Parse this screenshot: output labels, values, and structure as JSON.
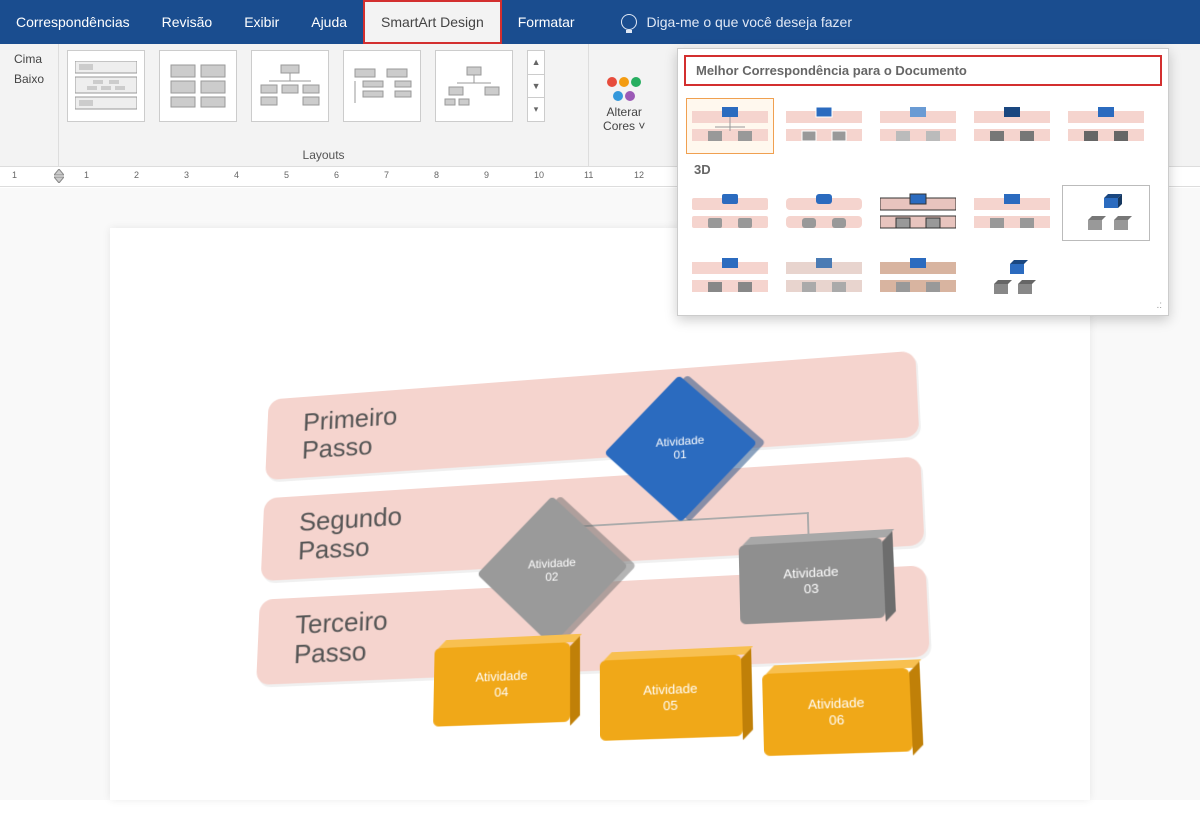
{
  "ribbon": {
    "tabs": [
      "Correspondências",
      "Revisão",
      "Exibir",
      "Ajuda",
      "SmartArt Design",
      "Formatar"
    ],
    "active_tab": "SmartArt Design",
    "tell_me": "Diga-me o que você deseja fazer",
    "move_up": "Cima",
    "move_down": "Baixo",
    "layouts_label": "Layouts",
    "change_colors": "Alterar Cores"
  },
  "gallery": {
    "best_match": "Melhor Correspondência para o Documento",
    "section_3d": "3D"
  },
  "smartart": {
    "step1": "Primeiro Passo",
    "step2": "Segundo Passo",
    "step3": "Terceiro Passo",
    "act1": "Atividade 01",
    "act2": "Atividade 02",
    "act3": "Atividade 03",
    "act4": "Atividade 04",
    "act5": "Atividade 05",
    "act6": "Atividade 06"
  },
  "ruler": {
    "numbers": [
      "1",
      "1",
      "2",
      "3",
      "4",
      "5",
      "6",
      "7",
      "8",
      "9",
      "10",
      "11",
      "12"
    ]
  }
}
